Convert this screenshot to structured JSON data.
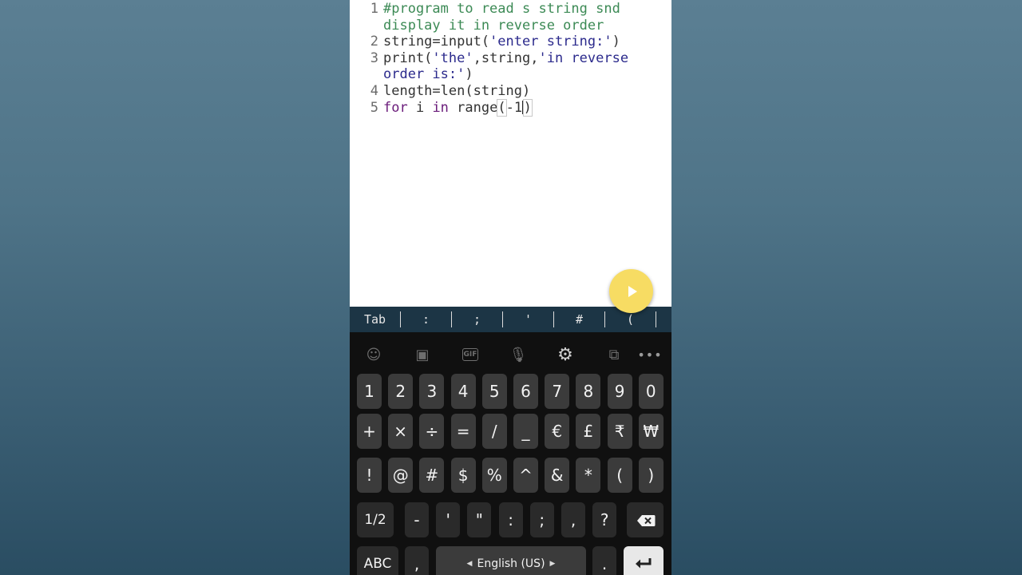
{
  "editor": {
    "lines": [
      {
        "num": "1",
        "parts": [
          {
            "t": "#program to read s string snd display it in reverse order",
            "c": "cm"
          }
        ]
      },
      {
        "num": "2",
        "parts": [
          {
            "t": "string=input(",
            "c": ""
          },
          {
            "t": "'enter string:'",
            "c": "str"
          },
          {
            "t": ")",
            "c": ""
          }
        ]
      },
      {
        "num": "3",
        "parts": [
          {
            "t": "print(",
            "c": ""
          },
          {
            "t": "'the'",
            "c": "str"
          },
          {
            "t": ",string,",
            "c": ""
          },
          {
            "t": "'in reverse order is:'",
            "c": "str"
          },
          {
            "t": ")",
            "c": ""
          }
        ]
      },
      {
        "num": "4",
        "parts": [
          {
            "t": "length=len(string)",
            "c": ""
          }
        ]
      },
      {
        "num": "5",
        "parts": [
          {
            "t": "for",
            "c": "kw"
          },
          {
            "t": " i ",
            "c": ""
          },
          {
            "t": "in",
            "c": "kw"
          },
          {
            "t": " range",
            "c": ""
          },
          {
            "t": "(",
            "c": "bracket"
          },
          {
            "t": "-1",
            "c": ""
          },
          {
            "t": "",
            "c": "caret"
          },
          {
            "t": ")",
            "c": "bracket"
          }
        ]
      }
    ]
  },
  "run_button": {
    "icon": "play-icon",
    "color": "#f7dc63"
  },
  "extra_keys": [
    "Tab",
    ":",
    ";",
    "'",
    "#",
    "("
  ],
  "toolbar": {
    "icons": [
      "emoji-icon",
      "sticker-icon",
      "gif-icon",
      "microphone-icon",
      "gear-icon",
      "clipboard-translate-icon",
      "more-icon"
    ],
    "gif_label": "GIF"
  },
  "keyboard": {
    "row1": [
      "1",
      "2",
      "3",
      "4",
      "5",
      "6",
      "7",
      "8",
      "9",
      "0"
    ],
    "row2": [
      "+",
      "×",
      "÷",
      "=",
      "/",
      "_",
      "€",
      "£",
      "₹",
      "₩"
    ],
    "row3": [
      "!",
      "@",
      "#",
      "$",
      "%",
      "^",
      "&",
      "*",
      "(",
      ")"
    ],
    "row4": {
      "toggle": "1/2",
      "keys": [
        "-",
        "'",
        "\"",
        ":",
        ";",
        ",",
        "?"
      ],
      "backspace_icon": "backspace-icon"
    },
    "row5": {
      "abc": "ABC",
      "comma": ",",
      "space_label": "English (US)",
      "period": ".",
      "enter_icon": "enter-icon"
    }
  },
  "colors": {
    "comment": "#3c8a55",
    "string": "#2b2a8c",
    "keyword": "#6a1b7a",
    "extra_bar": "#1c3545",
    "keyboard_bg": "#101010",
    "key": "#3b3b3b"
  }
}
